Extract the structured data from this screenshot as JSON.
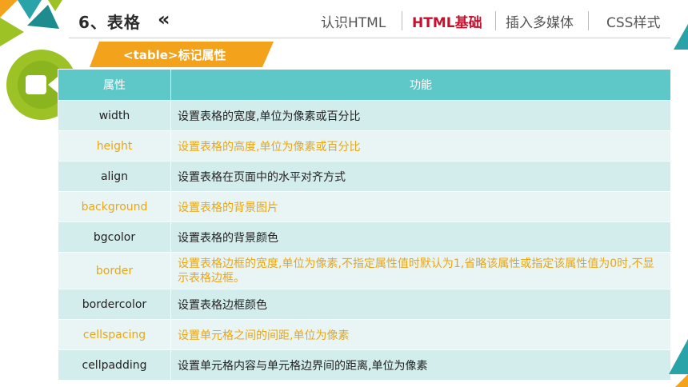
{
  "header": {
    "title": "6、表格",
    "chevrons": "«",
    "nav": [
      {
        "label": "认识HTML",
        "active": false
      },
      {
        "label": "HTML基础",
        "active": true
      },
      {
        "label": "插入多媒体",
        "active": false
      },
      {
        "label": "CSS样式",
        "active": false
      }
    ]
  },
  "section": {
    "title": "<table>标记属性"
  },
  "icons": {
    "badge": "video-camera-icon"
  },
  "colors": {
    "accent_teal": "#5ec8c8",
    "accent_orange": "#f2a31b",
    "accent_green": "#9cc225",
    "active_nav": "#c8102e"
  },
  "table": {
    "headers": [
      "属性",
      "功能"
    ],
    "rows": [
      {
        "attr": "width",
        "desc": "设置表格的宽度,单位为像素或百分比"
      },
      {
        "attr": "height",
        "desc": "设置表格的高度,单位为像素或百分比"
      },
      {
        "attr": "align",
        "desc": "设置表格在页面中的水平对齐方式"
      },
      {
        "attr": "background",
        "desc": "设置表格的背景图片"
      },
      {
        "attr": "bgcolor",
        "desc": "设置表格的背景颜色"
      },
      {
        "attr": "border",
        "desc": "设置表格边框的宽度,单位为像素,不指定属性值时默认为1,省略该属性或指定该属性值为0时,不显示表格边框。"
      },
      {
        "attr": "bordercolor",
        "desc": "设置表格边框颜色"
      },
      {
        "attr": "cellspacing",
        "desc": "设置单元格之间的间距,单位为像素"
      },
      {
        "attr": "cellpadding",
        "desc": "设置单元格内容与单元格边界间的距离,单位为像素"
      }
    ]
  }
}
